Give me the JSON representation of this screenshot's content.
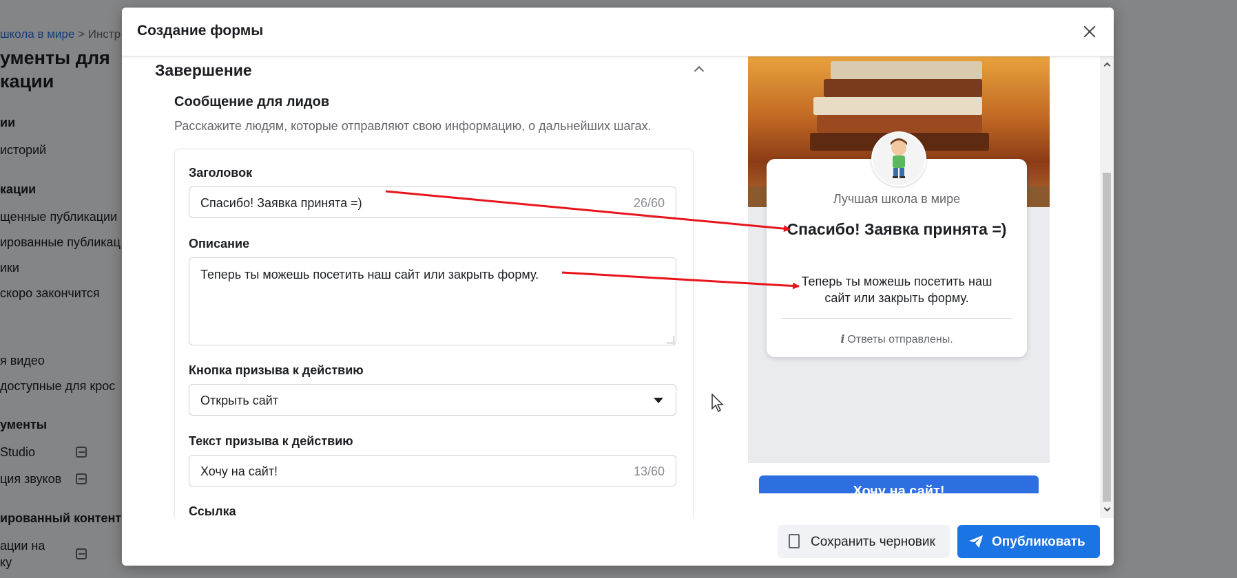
{
  "background": {
    "breadcrumb": {
      "link": "школа в мире",
      "separator": ">",
      "current": "Инстр"
    },
    "title": "ументы для\nкации",
    "items": [
      {
        "label": "ии",
        "heading": true
      },
      {
        "label": "историй",
        "heading": false
      },
      {
        "label": "кации",
        "heading": true
      },
      {
        "label": "щенные публикации",
        "heading": false
      },
      {
        "label": "ированные публикац",
        "heading": false
      },
      {
        "label": "ики",
        "heading": false
      },
      {
        "label": "скоро закончится",
        "heading": false
      },
      {
        "label": "я видео",
        "heading": false
      },
      {
        "label": "доступные для крос",
        "heading": false
      },
      {
        "label": "ументы",
        "heading": true
      },
      {
        "label": "Studio",
        "heading": false
      },
      {
        "label": "ция звуков",
        "heading": false
      },
      {
        "label": "ированный контент",
        "heading": true
      },
      {
        "label": "ации на",
        "heading": false
      },
      {
        "label": "ку",
        "heading": false
      }
    ]
  },
  "modal": {
    "title": "Создание формы",
    "section_title": "Завершение",
    "subsection_title": "Сообщение для лидов",
    "subsection_desc": "Расскажите людям, которые отправляют свою информацию, о дальнейших шагах.",
    "fields": {
      "headline": {
        "label": "Заголовок",
        "value": "Спасибо! Заявка принята =)",
        "counter": "26/60"
      },
      "description": {
        "label": "Описание",
        "value": "Теперь ты можешь посетить наш сайт или закрыть форму."
      },
      "cta_button": {
        "label": "Кнопка призыва к действию",
        "value": "Открыть сайт"
      },
      "cta_text": {
        "label": "Текст призыва к действию",
        "value": "Хочу на сайт!",
        "counter": "13/60"
      },
      "link": {
        "label": "Ссылка"
      }
    },
    "preview": {
      "school_name": "Лучшая школа в мире",
      "headline": "Спасибо! Заявка принята =)",
      "description": "Теперь ты можешь посетить наш сайт или закрыть форму.",
      "info_text": "Ответы отправлены.",
      "info_icon": "i",
      "cta": "Хочу на сайт!"
    },
    "footer": {
      "save_draft": "Сохранить черновик",
      "publish": "Опубликовать"
    }
  },
  "colors": {
    "accent": "#1b74e4",
    "annotation_arrow": "#e8141b"
  }
}
